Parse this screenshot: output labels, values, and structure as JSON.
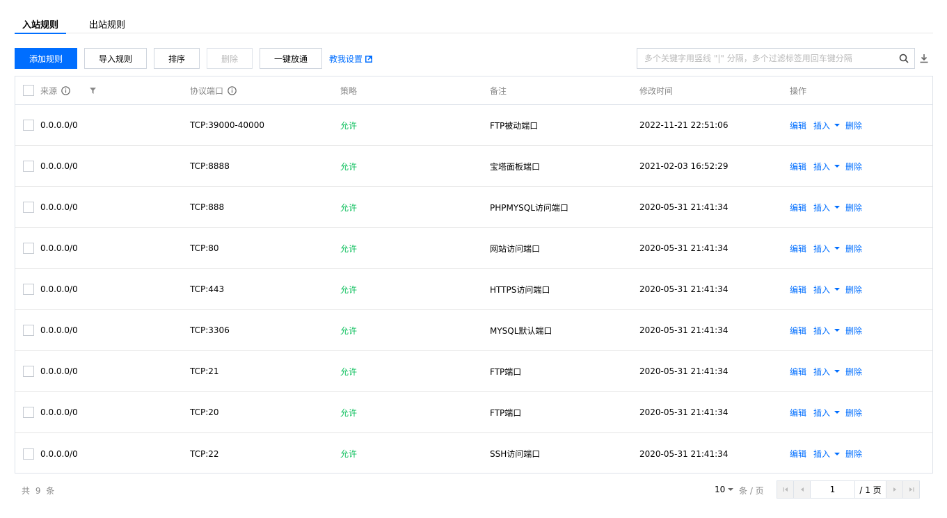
{
  "tabs": [
    {
      "label": "入站规则",
      "active": true
    },
    {
      "label": "出站规则",
      "active": false
    }
  ],
  "toolbar": {
    "add": "添加规则",
    "import": "导入规则",
    "sort": "排序",
    "delete": "删除",
    "open_all": "一键放通",
    "guide": "教我设置",
    "search_placeholder": "多个关键字用竖线 \"|\" 分隔，多个过滤标签用回车键分隔"
  },
  "table": {
    "headers": {
      "source": "来源",
      "port": "协议端口",
      "policy": "策略",
      "note": "备注",
      "modified": "修改时间",
      "ops": "操作"
    },
    "rows": [
      {
        "source": "0.0.0.0/0",
        "port": "TCP:39000-40000",
        "policy": "允许",
        "note": "FTP被动端口",
        "modified": "2022-11-21 22:51:06"
      },
      {
        "source": "0.0.0.0/0",
        "port": "TCP:8888",
        "policy": "允许",
        "note": "宝塔面板端口",
        "modified": "2021-02-03 16:52:29"
      },
      {
        "source": "0.0.0.0/0",
        "port": "TCP:888",
        "policy": "允许",
        "note": "PHPMYSQL访问端口",
        "modified": "2020-05-31 21:41:34"
      },
      {
        "source": "0.0.0.0/0",
        "port": "TCP:80",
        "policy": "允许",
        "note": "网站访问端口",
        "modified": "2020-05-31 21:41:34"
      },
      {
        "source": "0.0.0.0/0",
        "port": "TCP:443",
        "policy": "允许",
        "note": "HTTPS访问端口",
        "modified": "2020-05-31 21:41:34"
      },
      {
        "source": "0.0.0.0/0",
        "port": "TCP:3306",
        "policy": "允许",
        "note": "MYSQL默认端口",
        "modified": "2020-05-31 21:41:34"
      },
      {
        "source": "0.0.0.0/0",
        "port": "TCP:21",
        "policy": "允许",
        "note": "FTP端口",
        "modified": "2020-05-31 21:41:34"
      },
      {
        "source": "0.0.0.0/0",
        "port": "TCP:20",
        "policy": "允许",
        "note": "FTP端口",
        "modified": "2020-05-31 21:41:34"
      },
      {
        "source": "0.0.0.0/0",
        "port": "TCP:22",
        "policy": "允许",
        "note": "SSH访问端口",
        "modified": "2020-05-31 21:41:34"
      }
    ],
    "op_labels": {
      "edit": "编辑",
      "insert": "插入",
      "delete": "删除"
    }
  },
  "footer": {
    "total": "共 9 条",
    "page_size": "10",
    "per_page": "条 / 页",
    "current_page": "1",
    "total_pages": "/ 1 页"
  },
  "colors": {
    "accent": "#006eff",
    "allow": "#0abf5b",
    "border": "#dde2e9"
  }
}
